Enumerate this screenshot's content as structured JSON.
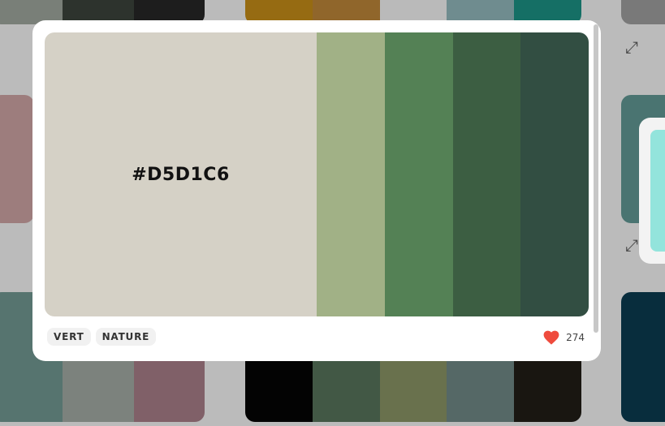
{
  "palette": {
    "selected_hex": "#D5D1C6",
    "colors": [
      "#D5D1C6",
      "#A1B186",
      "#548155",
      "#3C5E42",
      "#324E42"
    ]
  },
  "tags": [
    {
      "label": "VERT"
    },
    {
      "label": "NATURE"
    }
  ],
  "likes": {
    "count": "274",
    "icon": "heart-icon",
    "color": "#EF4B3D"
  },
  "background": {
    "expand_icon": "expand-icon",
    "peek_color": "#93E4DC"
  }
}
